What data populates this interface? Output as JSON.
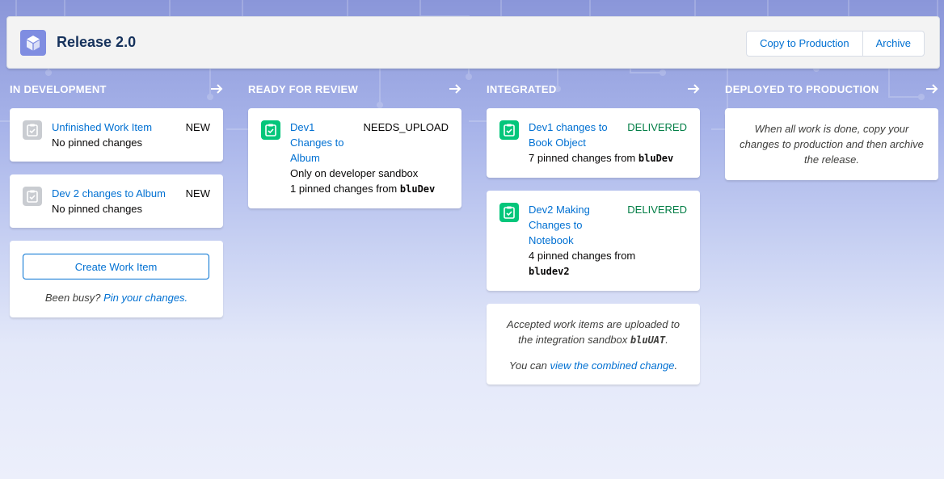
{
  "header": {
    "title": "Release 2.0",
    "copy_button": "Copy to Production",
    "archive_button": "Archive"
  },
  "columns": [
    {
      "title": "IN DEVELOPMENT",
      "cards": [
        {
          "link": "Unfinished Work Item",
          "status": "NEW",
          "detail": "No pinned changes"
        },
        {
          "link": "Dev 2 changes to Album",
          "status": "NEW",
          "detail": "No pinned changes"
        }
      ],
      "create_button": "Create Work Item",
      "busy_prefix": "Been busy?",
      "busy_link": "Pin your changes."
    },
    {
      "title": "READY FOR REVIEW",
      "cards": [
        {
          "link": "Dev1 Changes to Album",
          "status": "NEEDS_UPLOAD",
          "detail1": "Only on developer sandbox",
          "detail_prefix": "1 pinned changes from",
          "detail_code": "bluDev"
        }
      ]
    },
    {
      "title": "INTEGRATED",
      "cards": [
        {
          "link": "Dev1 changes to Book Object",
          "status": "DELIVERED",
          "detail_prefix": "7 pinned changes from",
          "detail_code": "bluDev"
        },
        {
          "link": "Dev2 Making Changes to Notebook",
          "status": "DELIVERED",
          "detail_prefix": "4 pinned changes from",
          "detail_code": "bludev2"
        }
      ],
      "note": {
        "line_prefix": "Accepted work items are uploaded to the integration sandbox",
        "line_code": "bluUAT",
        "line_suffix": ".",
        "line2_prefix": "You can",
        "line2_link": "view the combined change",
        "line2_suffix": "."
      }
    },
    {
      "title": "DEPLOYED TO PRODUCTION",
      "note": "When all work is done, copy your changes to production and then archive the release."
    }
  ],
  "colors": {
    "link": "#0070d2",
    "delivered": "#027e46",
    "work_item_new": "#c9ccd1",
    "work_item_done": "#04c67b",
    "app_icon": "#7f8de1"
  },
  "icons": {
    "app": "cube-icon",
    "work_item": "clipboard-icon",
    "column_arrow": "arrow-right-icon"
  }
}
